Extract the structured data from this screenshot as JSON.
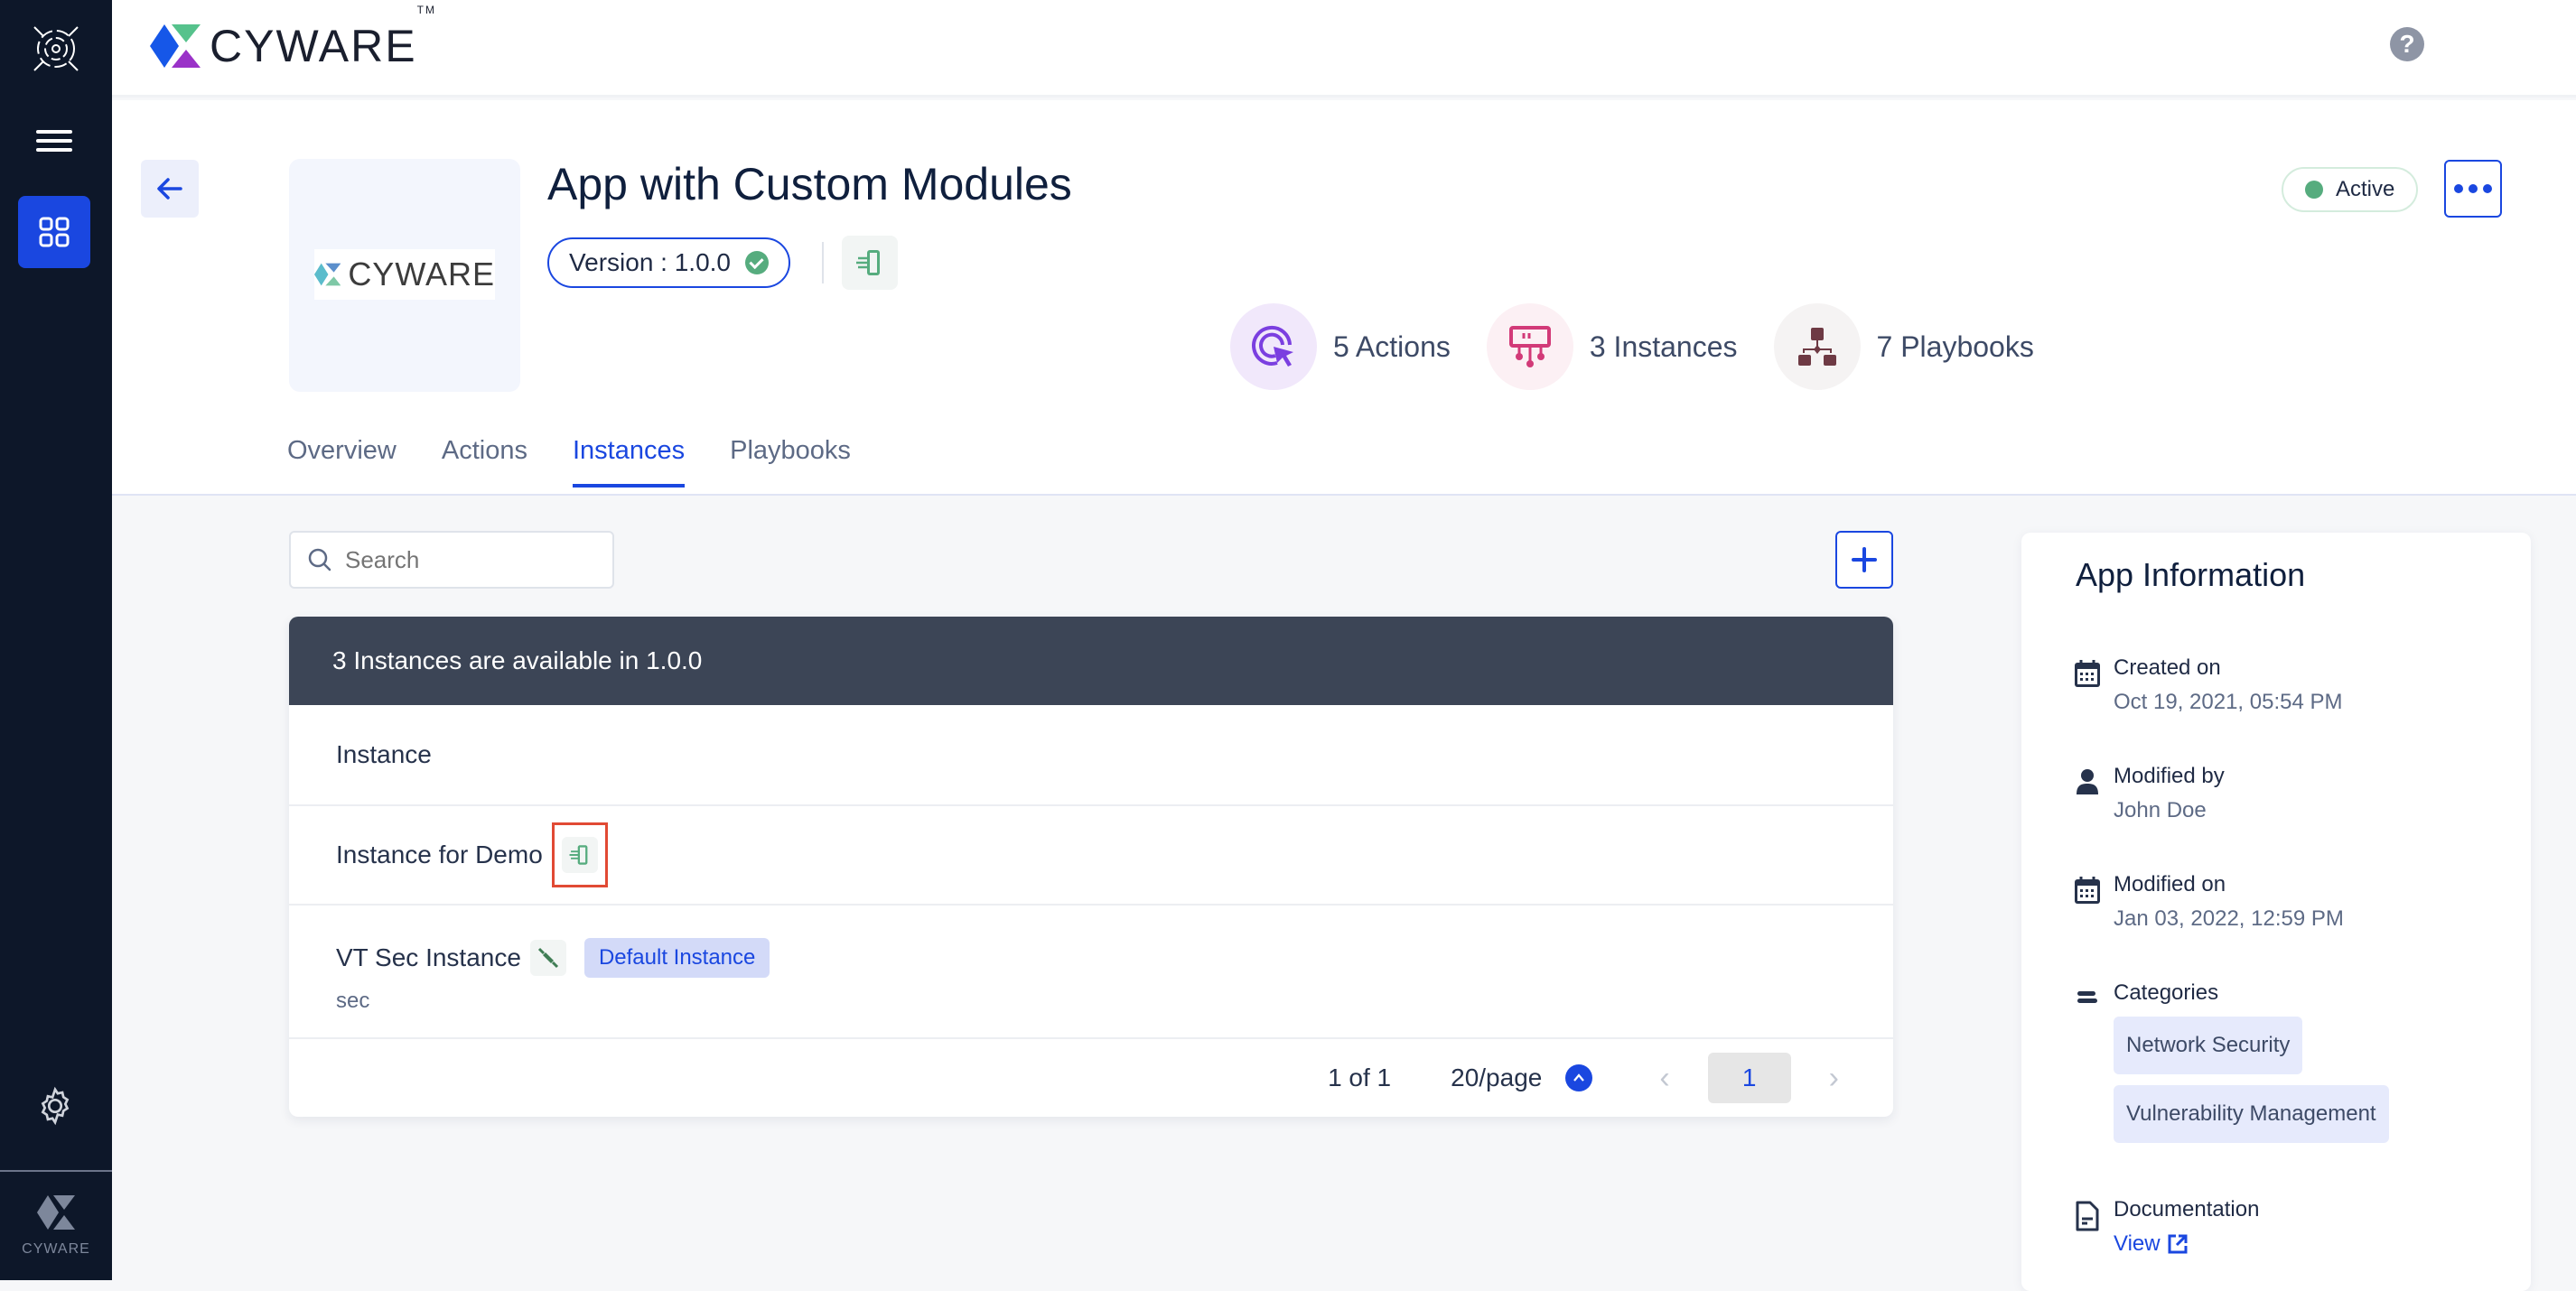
{
  "sidebar": {
    "brand_text": "CYWARE"
  },
  "topbar": {
    "logo_text": "CYWARE",
    "tm": "TM"
  },
  "header": {
    "app_logo_text": "CYWARE",
    "title": "App with Custom Modules",
    "version_label": "Version : 1.0.0",
    "status": "Active",
    "colors": {
      "accent": "#1a47e0",
      "success": "#56ac7e"
    },
    "stats": [
      {
        "label": "5 Actions",
        "icon": "actions-cursor-icon",
        "color": "#7b3fe0",
        "bg": "#f1e8fb"
      },
      {
        "label": "3 Instances",
        "icon": "instances-icon",
        "color": "#d23a78",
        "bg": "#fcf0f4"
      },
      {
        "label": "7 Playbooks",
        "icon": "playbooks-icon",
        "color": "#6e3a44",
        "bg": "#f5f3f3"
      }
    ]
  },
  "tabs": [
    {
      "label": "Overview",
      "active": false
    },
    {
      "label": "Actions",
      "active": false
    },
    {
      "label": "Instances",
      "active": true
    },
    {
      "label": "Playbooks",
      "active": false
    }
  ],
  "search": {
    "placeholder": "Search",
    "value": ""
  },
  "table": {
    "banner": "3 Instances are available in 1.0.0",
    "column_header": "Instance",
    "rows": [
      {
        "name": "Instance for Demo",
        "icon": "log-doc-icon"
      },
      {
        "name": "VT Sec Instance",
        "icon": "plug-connected-icon",
        "badge": "Default Instance",
        "subtitle": "sec"
      }
    ],
    "pager": {
      "summary": "1 of 1",
      "per_page": "20/page",
      "current_page": "1"
    }
  },
  "app_info": {
    "title": "App Information",
    "created_label": "Created on",
    "created_value": "Oct 19, 2021, 05:54 PM",
    "modified_by_label": "Modified by",
    "modified_by_value": "John Doe",
    "modified_on_label": "Modified on",
    "modified_on_value": "Jan 03, 2022, 12:59 PM",
    "categories_label": "Categories",
    "categories": [
      "Network Security",
      "Vulnerability Management"
    ],
    "documentation_label": "Documentation",
    "documentation_link": "View"
  }
}
